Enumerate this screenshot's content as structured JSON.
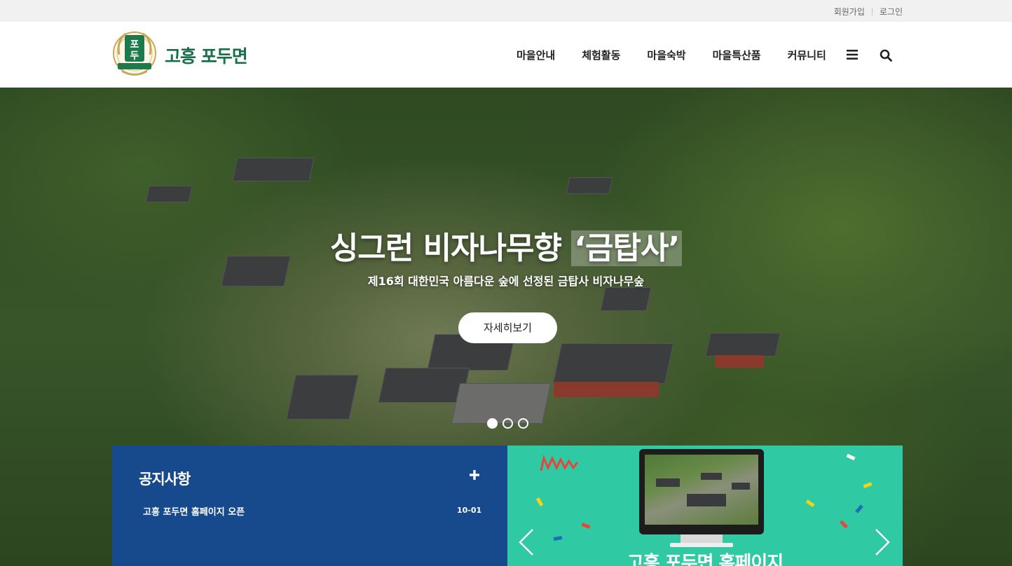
{
  "topbar": {
    "join_label": "회원가입",
    "login_label": "로그인"
  },
  "header": {
    "logo_title": "고흥 포두면",
    "nav": [
      "마을안내",
      "체험활동",
      "마을숙박",
      "마을특산품",
      "커뮤니티"
    ]
  },
  "hero": {
    "title_main": "싱그런 비자나무향 ",
    "title_highlight": "‘금탑사’",
    "subtitle": "제16회 대한민국 아름다운 숲에 선정된 금탑사 비자나무숲",
    "button_label": "자세히보기",
    "slide_count": 3,
    "active_slide": 1
  },
  "notice": {
    "title": "공지사항",
    "items": [
      {
        "title": "고흥 포두면 홈페이지 오픈",
        "date": "10-01"
      }
    ]
  },
  "promo": {
    "text": "고흥 포두면 홈페이지"
  },
  "colors": {
    "brand_green": "#17704a",
    "notice_blue": "#174a8c",
    "promo_teal": "#2fc9a3",
    "topbar_gray": "#f1f1f1"
  }
}
